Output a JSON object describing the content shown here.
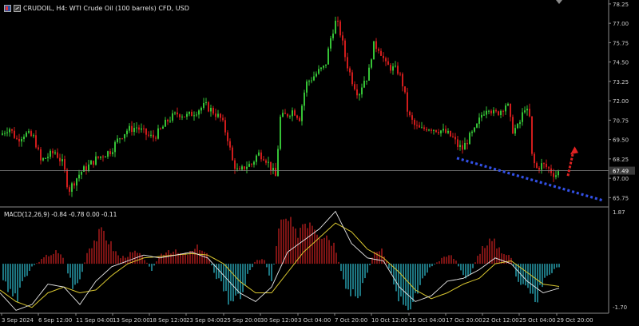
{
  "header": {
    "title": "CRUDOIL, H4:  WTI Crude Oil (100 barrels) CFD, USD"
  },
  "price_axis": {
    "labels": [
      "78.25",
      "77.00",
      "75.75",
      "74.50",
      "73.25",
      "72.00",
      "70.75",
      "69.50",
      "68.25",
      "67.00",
      "65.75"
    ],
    "current_price": "67.49"
  },
  "macd": {
    "label": "MACD(12,26,9) -0.84 -0.78 0.00 -0.11",
    "axis_labels": [
      "1.87",
      "-1.70"
    ]
  },
  "time_axis": {
    "labels": [
      "3 Sep 2024",
      "6 Sep 12:00",
      "11 Sep 04:00",
      "13 Sep 20:00",
      "18 Sep 12:00",
      "23 Sep 04:00",
      "25 Sep 20:00",
      "30 Sep 12:00",
      "3 Oct 04:00",
      "7 Oct 20:00",
      "10 Oct 12:00",
      "15 Oct 04:00",
      "17 Oct 20:00",
      "22 Oct 12:00",
      "25 Oct 04:00",
      "29 Oct 20:00"
    ]
  },
  "colors": {
    "bull": "#35c236",
    "bear": "#d01c1c",
    "macd_line": "#e8e8e8",
    "signal_line": "#d8c630",
    "hist_pos": "#b21c1c",
    "hist_neg": "#2aa8b8",
    "trendline": "#3250e6",
    "arrow": "#e02222",
    "grid_text": "#cfcfcf"
  },
  "chart_data": {
    "type": "candlestick",
    "title": "CRUDOIL, H4:  WTI Crude Oil (100 barrels) CFD, USD",
    "ylim": [
      65.2,
      78.4
    ],
    "current_price": 67.49,
    "close_path": [
      [
        0,
        69.8
      ],
      [
        10,
        70.3
      ],
      [
        20,
        69.5
      ],
      [
        30,
        69.9
      ],
      [
        42,
        69.6
      ],
      [
        50,
        68.1
      ],
      [
        58,
        68.4
      ],
      [
        68,
        68.7
      ],
      [
        78,
        67.9
      ],
      [
        85,
        66.2
      ],
      [
        92,
        66.8
      ],
      [
        100,
        67.4
      ],
      [
        108,
        67.7
      ],
      [
        118,
        68.2
      ],
      [
        128,
        68.5
      ],
      [
        138,
        68.8
      ],
      [
        148,
        69.6
      ],
      [
        158,
        70.1
      ],
      [
        170,
        70.3
      ],
      [
        180,
        69.9
      ],
      [
        190,
        69.6
      ],
      [
        200,
        70.1
      ],
      [
        210,
        70.8
      ],
      [
        222,
        71.2
      ],
      [
        234,
        71.0
      ],
      [
        246,
        71.4
      ],
      [
        256,
        71.7
      ],
      [
        266,
        71.3
      ],
      [
        276,
        70.8
      ],
      [
        284,
        69.6
      ],
      [
        290,
        68.1
      ],
      [
        298,
        67.3
      ],
      [
        306,
        67.8
      ],
      [
        314,
        67.9
      ],
      [
        322,
        68.6
      ],
      [
        330,
        68.4
      ],
      [
        338,
        67.7
      ],
      [
        344,
        67.1
      ],
      [
        350,
        70.9
      ],
      [
        358,
        71.1
      ],
      [
        366,
        71.4
      ],
      [
        374,
        70.9
      ],
      [
        382,
        73.1
      ],
      [
        390,
        73.5
      ],
      [
        398,
        73.9
      ],
      [
        406,
        74.2
      ],
      [
        414,
        76.3
      ],
      [
        420,
        77.2
      ],
      [
        426,
        76.2
      ],
      [
        432,
        74.6
      ],
      [
        440,
        73.3
      ],
      [
        448,
        72.4
      ],
      [
        454,
        73.3
      ],
      [
        460,
        73.6
      ],
      [
        466,
        75.6
      ],
      [
        474,
        75.4
      ],
      [
        482,
        74.3
      ],
      [
        490,
        74.1
      ],
      [
        498,
        73.9
      ],
      [
        504,
        72.9
      ],
      [
        510,
        71.1
      ],
      [
        518,
        70.4
      ],
      [
        526,
        70.1
      ],
      [
        534,
        70.3
      ],
      [
        542,
        70.2
      ],
      [
        550,
        70.1
      ],
      [
        558,
        69.9
      ],
      [
        566,
        69.6
      ],
      [
        572,
        69.1
      ],
      [
        578,
        68.9
      ],
      [
        586,
        69.6
      ],
      [
        594,
        70.1
      ],
      [
        602,
        71.1
      ],
      [
        610,
        71.7
      ],
      [
        618,
        71.1
      ],
      [
        626,
        71.4
      ],
      [
        634,
        71.9
      ],
      [
        640,
        70.1
      ],
      [
        648,
        70.3
      ],
      [
        656,
        71.6
      ],
      [
        662,
        70.9
      ],
      [
        664,
        68.6
      ],
      [
        670,
        67.6
      ],
      [
        678,
        67.9
      ],
      [
        686,
        67.6
      ],
      [
        694,
        67.2
      ],
      [
        700,
        67.49
      ]
    ],
    "annotations": [
      {
        "type": "trendline",
        "color": "blue",
        "style": "dotted",
        "from": [
          "17 Oct 20:00",
          68.3
        ],
        "to": [
          "beyond 29 Oct 20:00",
          65.5
        ]
      },
      {
        "type": "arrow",
        "color": "red",
        "style": "dotted",
        "direction": "up",
        "from": 67.2,
        "to": 68.9
      }
    ],
    "macd": {
      "params": "12,26,9",
      "values": [
        -0.84,
        -0.78,
        0.0,
        -0.11
      ],
      "ylim": [
        -1.7,
        1.87
      ],
      "histogram_path": [
        [
          0,
          -0.5
        ],
        [
          10,
          -0.8
        ],
        [
          20,
          -1.2
        ],
        [
          30,
          -0.5
        ],
        [
          40,
          -0.1
        ],
        [
          50,
          0.1
        ],
        [
          60,
          0.3
        ],
        [
          70,
          0.4
        ],
        [
          80,
          0.2
        ],
        [
          90,
          -0.8
        ],
        [
          100,
          -0.6
        ],
        [
          110,
          0.5
        ],
        [
          120,
          0.9
        ],
        [
          130,
          1.1
        ],
        [
          140,
          0.6
        ],
        [
          150,
          0.2
        ],
        [
          160,
          0.3
        ],
        [
          170,
          0.4
        ],
        [
          180,
          0.2
        ],
        [
          190,
          -0.2
        ],
        [
          200,
          0.3
        ],
        [
          210,
          0.5
        ],
        [
          220,
          0.4
        ],
        [
          230,
          0.3
        ],
        [
          240,
          0.4
        ],
        [
          250,
          0.6
        ],
        [
          260,
          0.3
        ],
        [
          270,
          -0.4
        ],
        [
          280,
          -0.9
        ],
        [
          290,
          -1.5
        ],
        [
          300,
          -1.1
        ],
        [
          310,
          -0.4
        ],
        [
          320,
          0.1
        ],
        [
          330,
          0.2
        ],
        [
          340,
          -0.6
        ],
        [
          350,
          1.3
        ],
        [
          360,
          1.5
        ],
        [
          370,
          1.0
        ],
        [
          380,
          1.5
        ],
        [
          390,
          1.6
        ],
        [
          400,
          1.1
        ],
        [
          410,
          1.0
        ],
        [
          420,
          0.6
        ],
        [
          430,
          -0.7
        ],
        [
          440,
          -1.2
        ],
        [
          450,
          -1.0
        ],
        [
          460,
          -0.3
        ],
        [
          470,
          0.5
        ],
        [
          480,
          0.4
        ],
        [
          490,
          -0.4
        ],
        [
          500,
          -1.2
        ],
        [
          510,
          -1.5
        ],
        [
          520,
          -1.1
        ],
        [
          530,
          -0.4
        ],
        [
          540,
          -0.1
        ],
        [
          550,
          0.1
        ],
        [
          560,
          0.3
        ],
        [
          570,
          0.2
        ],
        [
          580,
          -0.5
        ],
        [
          590,
          -0.3
        ],
        [
          600,
          0.4
        ],
        [
          610,
          0.8
        ],
        [
          620,
          0.7
        ],
        [
          630,
          0.4
        ],
        [
          640,
          0.2
        ],
        [
          650,
          -0.8
        ],
        [
          660,
          -1.0
        ],
        [
          670,
          -1.3
        ],
        [
          680,
          -0.6
        ],
        [
          690,
          -0.3
        ],
        [
          700,
          -0.1
        ]
      ],
      "macd_line_path": [
        [
          0,
          -1.0
        ],
        [
          20,
          -1.6
        ],
        [
          40,
          -1.4
        ],
        [
          60,
          -0.7
        ],
        [
          80,
          -0.8
        ],
        [
          100,
          -1.4
        ],
        [
          120,
          -0.6
        ],
        [
          140,
          -0.1
        ],
        [
          160,
          0.1
        ],
        [
          180,
          0.3
        ],
        [
          200,
          0.2
        ],
        [
          220,
          0.3
        ],
        [
          240,
          0.4
        ],
        [
          260,
          0.2
        ],
        [
          280,
          -0.4
        ],
        [
          300,
          -1.0
        ],
        [
          320,
          -1.3
        ],
        [
          340,
          -0.8
        ],
        [
          360,
          0.4
        ],
        [
          380,
          0.8
        ],
        [
          400,
          1.2
        ],
        [
          420,
          1.8
        ],
        [
          440,
          0.7
        ],
        [
          460,
          0.2
        ],
        [
          480,
          0.1
        ],
        [
          500,
          -0.8
        ],
        [
          520,
          -1.3
        ],
        [
          540,
          -1.1
        ],
        [
          560,
          -0.6
        ],
        [
          580,
          -0.5
        ],
        [
          600,
          -0.2
        ],
        [
          620,
          0.2
        ],
        [
          640,
          0.0
        ],
        [
          660,
          -0.6
        ],
        [
          680,
          -1.0
        ],
        [
          700,
          -0.84
        ]
      ],
      "signal_line_path": [
        [
          0,
          -0.9
        ],
        [
          20,
          -1.3
        ],
        [
          40,
          -1.5
        ],
        [
          60,
          -1.0
        ],
        [
          80,
          -0.8
        ],
        [
          100,
          -1.0
        ],
        [
          120,
          -0.9
        ],
        [
          140,
          -0.4
        ],
        [
          160,
          0.0
        ],
        [
          180,
          0.2
        ],
        [
          200,
          0.25
        ],
        [
          220,
          0.3
        ],
        [
          240,
          0.35
        ],
        [
          260,
          0.3
        ],
        [
          280,
          0.0
        ],
        [
          300,
          -0.6
        ],
        [
          320,
          -1.0
        ],
        [
          340,
          -1.0
        ],
        [
          360,
          -0.3
        ],
        [
          380,
          0.4
        ],
        [
          400,
          0.9
        ],
        [
          420,
          1.4
        ],
        [
          440,
          1.1
        ],
        [
          460,
          0.5
        ],
        [
          480,
          0.2
        ],
        [
          500,
          -0.3
        ],
        [
          520,
          -0.9
        ],
        [
          540,
          -1.2
        ],
        [
          560,
          -1.0
        ],
        [
          580,
          -0.7
        ],
        [
          600,
          -0.5
        ],
        [
          620,
          0.0
        ],
        [
          640,
          0.1
        ],
        [
          660,
          -0.3
        ],
        [
          680,
          -0.7
        ],
        [
          700,
          -0.78
        ]
      ]
    }
  }
}
